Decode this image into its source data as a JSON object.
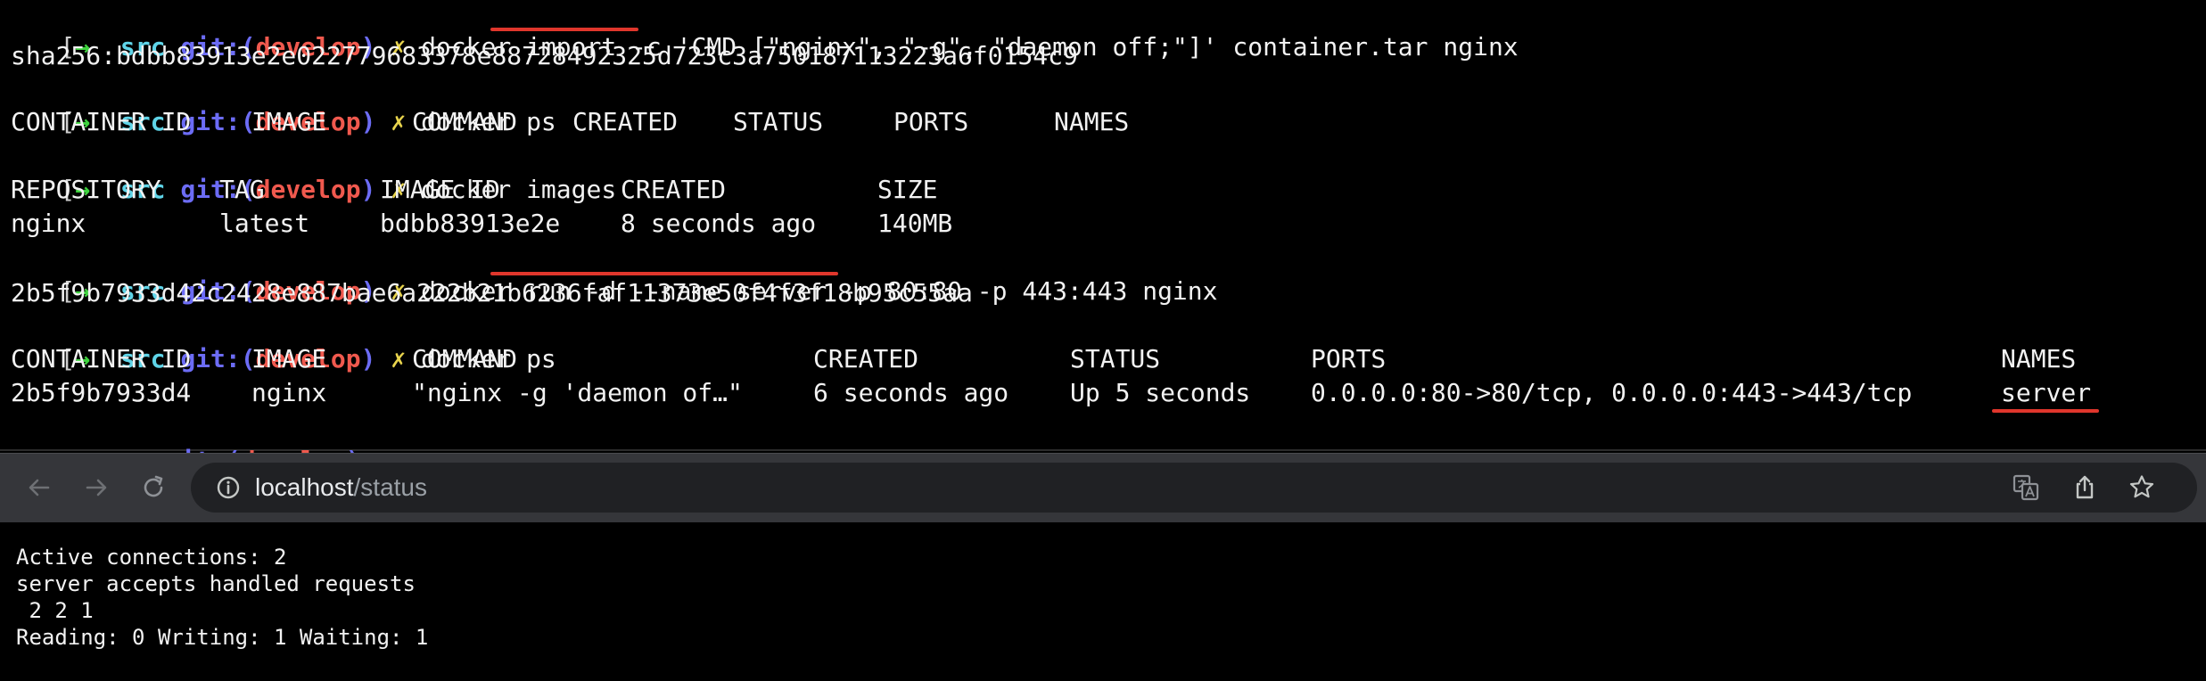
{
  "prompt": {
    "bracket": "[",
    "arrow": "→",
    "dir": "src",
    "git_prefix": "git:(",
    "branch": "develop",
    "git_suffix": ")",
    "dirty": "✗"
  },
  "terminal": {
    "cmd_import": "docker import -c 'CMD [\"nginx\", \"-g\", \"daemon off;\"]' container.tar nginx",
    "out_sha": "sha256:bdbb83913e2e022779683378e88728492325d723c3a750187113223a6f0154c9",
    "cmd_ps1": "docker ps",
    "ps1_headers": [
      "CONTAINER ID",
      "IMAGE",
      "COMMAND",
      "CREATED",
      "STATUS",
      "PORTS",
      "NAMES"
    ],
    "cmd_images": "docker images",
    "images_headers": [
      "REPOSITORY",
      "TAG",
      "IMAGE ID",
      "CREATED",
      "SIZE"
    ],
    "images_row": [
      "nginx",
      "latest",
      "bdbb83913e2e",
      "8 seconds ago",
      "140MB"
    ],
    "cmd_run": "docker run -d --name server -p 80:80 -p 443:443 nginx",
    "out_container_id": "2b5f9b7933d42c2428e887bae6a222b21b6236faf11373e50f4f3f18b95c55aa",
    "cmd_ps2": "docker ps",
    "ps2_headers": [
      "CONTAINER ID",
      "IMAGE",
      "COMMAND",
      "CREATED",
      "STATUS",
      "PORTS",
      "NAMES"
    ],
    "ps2_row": [
      "2b5f9b7933d4",
      "nginx",
      "\"nginx -g 'daemon of…\"",
      "6 seconds ago",
      "Up 5 seconds",
      "0.0.0.0:80->80/tcp, 0.0.0.0:443->443/tcp",
      "server"
    ]
  },
  "browser": {
    "url_host": "localhost",
    "url_path": "/status",
    "icons": [
      "back-icon",
      "forward-icon",
      "reload-icon",
      "info-icon",
      "translate-icon",
      "share-icon",
      "bookmark-star-icon"
    ]
  },
  "page": {
    "lines": [
      "Active connections: 2 ",
      "server accepts handled requests",
      " 2 2 1 ",
      "Reading: 0 Writing: 1 Waiting: 1 "
    ]
  },
  "colors": {
    "arrow": "#3ed23e",
    "dir": "#5fd4e8",
    "git": "#6c6cf5",
    "branch": "#f0594e",
    "dirty": "#e8d44d",
    "underline": "#e0362c"
  }
}
